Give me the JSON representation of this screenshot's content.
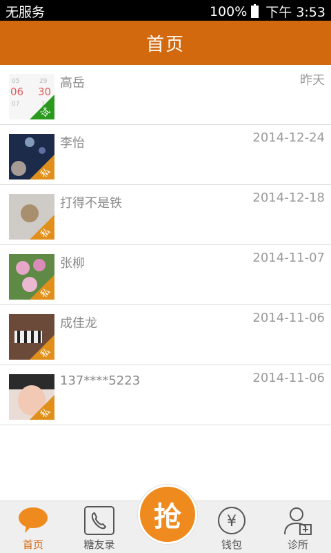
{
  "status_bar": {
    "carrier": "无服务",
    "battery": "100%",
    "time": "下午 3:53"
  },
  "header": {
    "title": "首页"
  },
  "contacts": [
    {
      "name": "高岳",
      "date": "昨天",
      "badge": "试",
      "badge_color": "#2a9a1f"
    },
    {
      "name": "李怡",
      "date": "2014-12-24",
      "badge": "私",
      "badge_color": "#e0901a"
    },
    {
      "name": "打得不是铁",
      "date": "2014-12-18",
      "badge": "私",
      "badge_color": "#e0901a"
    },
    {
      "name": "张柳",
      "date": "2014-11-07",
      "badge": "私",
      "badge_color": "#e0901a"
    },
    {
      "name": "成佳龙",
      "date": "2014-11-06",
      "badge": "私",
      "badge_color": "#e0901a"
    },
    {
      "name": "137****5223",
      "date": "2014-11-06",
      "badge": "私",
      "badge_color": "#e0901a"
    }
  ],
  "calendar_thumb": {
    "top_left": "05",
    "top_right": "29",
    "mid_left": "06",
    "mid_right": "30",
    "bottom_left": "07",
    "bottom_right": "1"
  },
  "tabbar": {
    "home": "首页",
    "contacts": "糖友录",
    "grab": "抢",
    "wallet": "钱包",
    "wallet_symbol": "¥",
    "clinic": "诊所"
  },
  "colors": {
    "accent": "#d3690e",
    "trial_badge": "#2a9a1f",
    "private_badge": "#e0901a"
  }
}
